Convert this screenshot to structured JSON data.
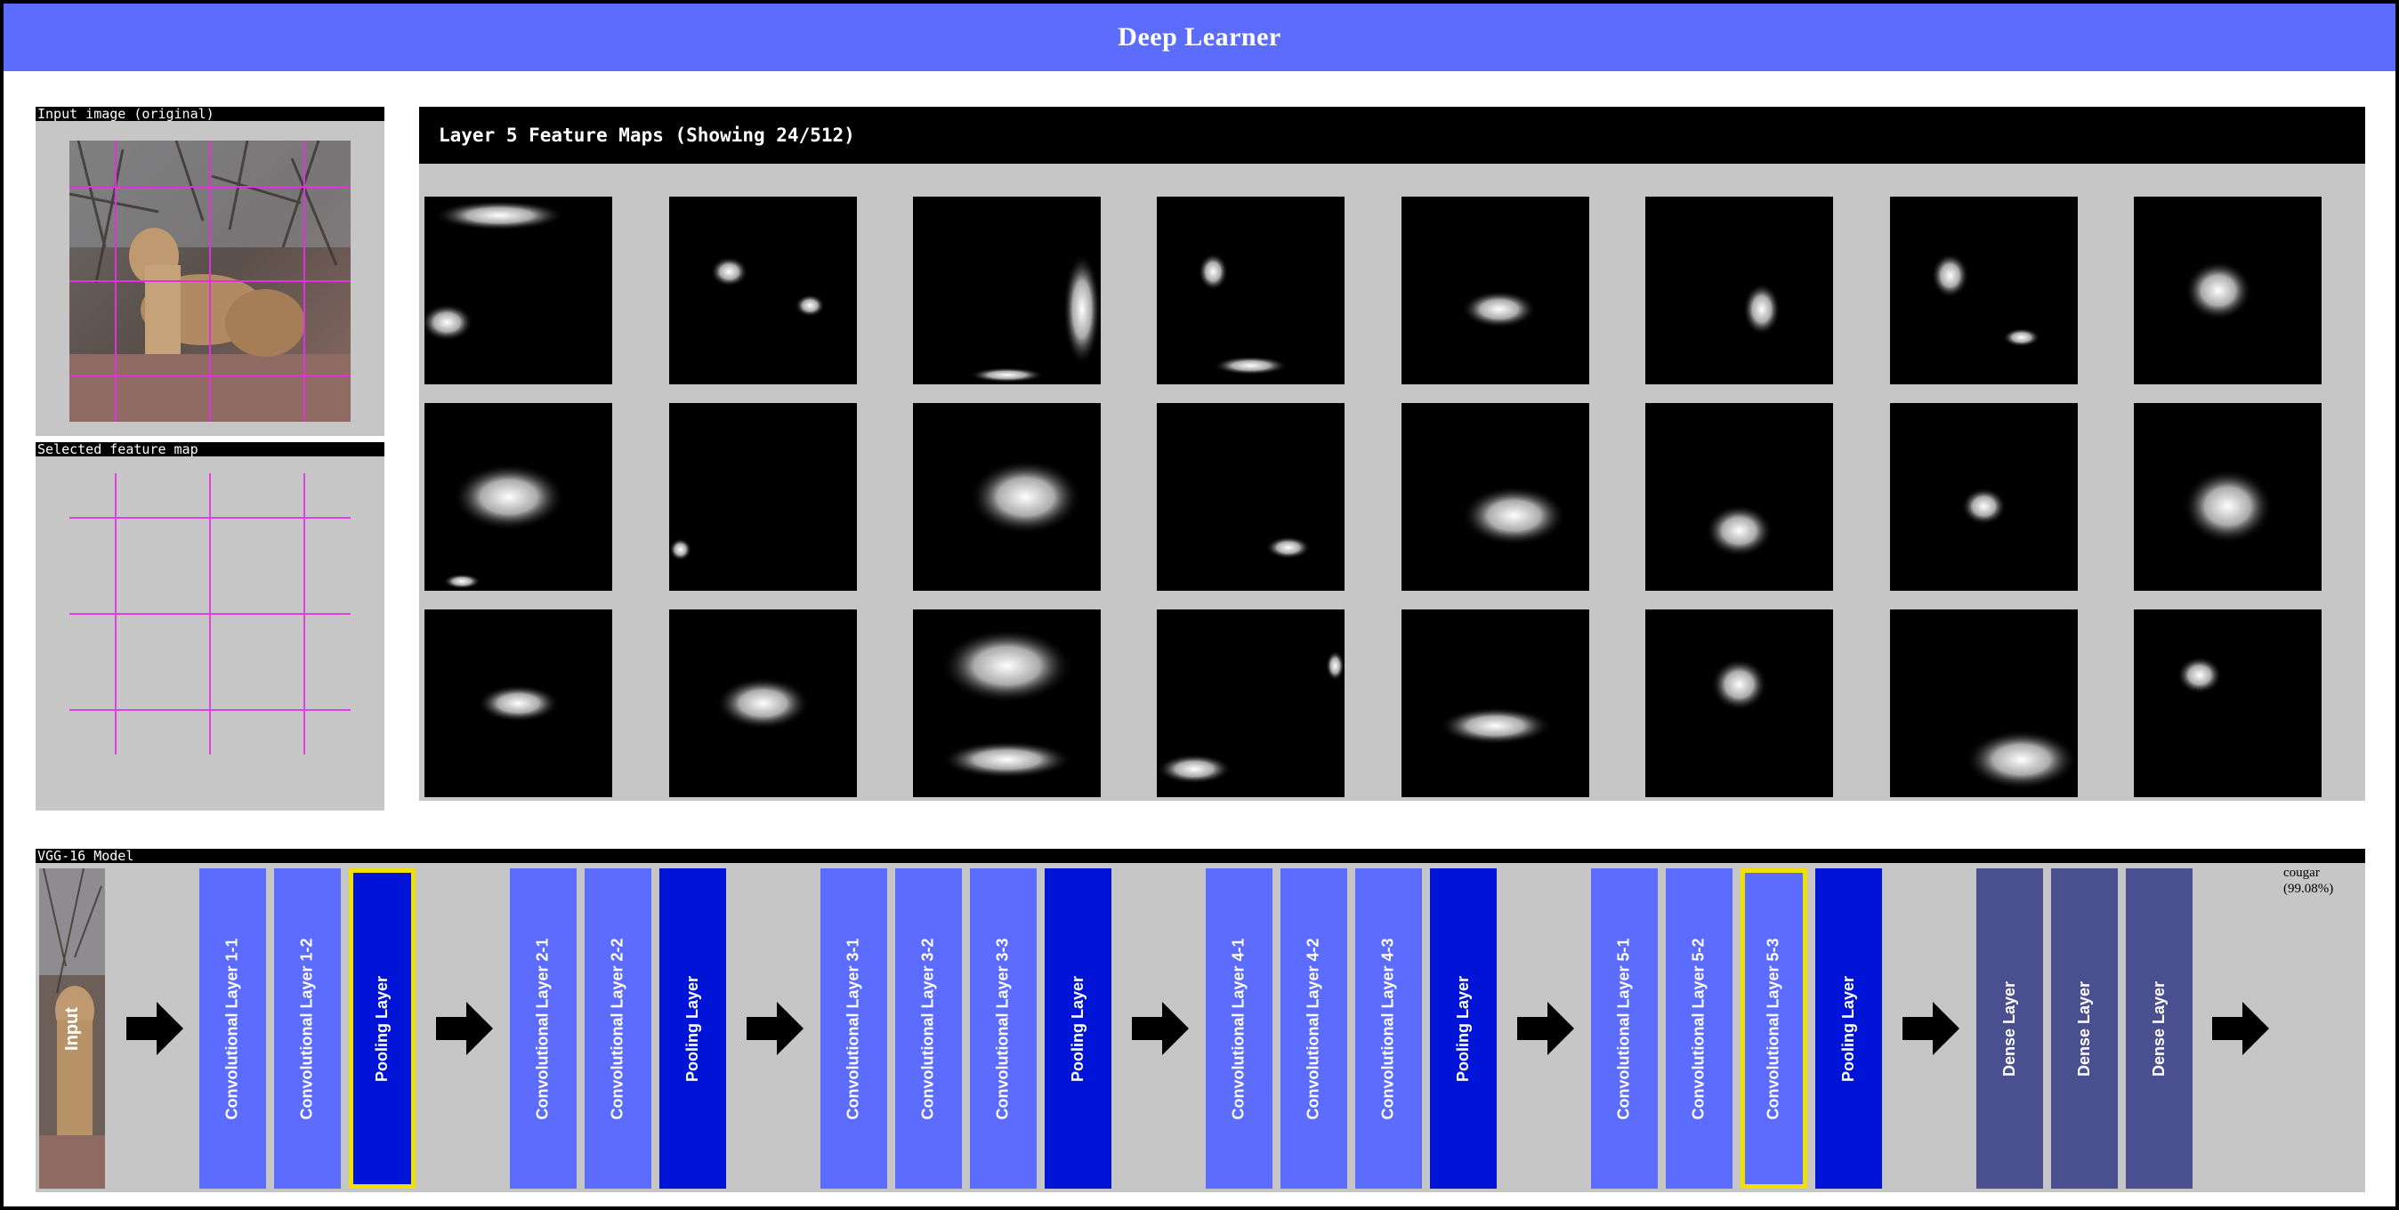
{
  "app": {
    "title": "Deep Learner"
  },
  "input_panel": {
    "label": "Input image (original)"
  },
  "selected_panel": {
    "label": "Selected feature map"
  },
  "feature_maps": {
    "title": "Layer 5 Feature Maps (Showing 24/512)"
  },
  "model": {
    "label": "VGG-16 Model",
    "input_label": "Input",
    "layers": [
      {
        "label": "Convolutional Layer 1-1",
        "type": "conv"
      },
      {
        "label": "Convolutional Layer 1-2",
        "type": "conv"
      },
      {
        "label": "Pooling Layer",
        "type": "pool",
        "selected": true
      },
      {
        "label": "Convolutional Layer 2-1",
        "type": "conv"
      },
      {
        "label": "Convolutional Layer 2-2",
        "type": "conv"
      },
      {
        "label": "Pooling Layer",
        "type": "pool"
      },
      {
        "label": "Convolutional Layer 3-1",
        "type": "conv"
      },
      {
        "label": "Convolutional Layer 3-2",
        "type": "conv"
      },
      {
        "label": "Convolutional Layer 3-3",
        "type": "conv"
      },
      {
        "label": "Pooling Layer",
        "type": "pool"
      },
      {
        "label": "Convolutional Layer 4-1",
        "type": "conv"
      },
      {
        "label": "Convolutional Layer 4-2",
        "type": "conv"
      },
      {
        "label": "Convolutional Layer 4-3",
        "type": "conv"
      },
      {
        "label": "Pooling Layer",
        "type": "pool"
      },
      {
        "label": "Convolutional Layer 5-1",
        "type": "conv"
      },
      {
        "label": "Convolutional Layer 5-2",
        "type": "conv"
      },
      {
        "label": "Convolutional Layer 5-3",
        "type": "conv",
        "selected": true
      },
      {
        "label": "Pooling Layer",
        "type": "pool"
      },
      {
        "label": "Dense Layer",
        "type": "dense"
      },
      {
        "label": "Dense Layer",
        "type": "dense"
      },
      {
        "label": "Dense Layer",
        "type": "dense"
      }
    ],
    "prediction": {
      "label": "cougar",
      "confidence": "(99.08%)"
    }
  },
  "colors": {
    "header": "#5b6cff",
    "conv": "#5b6cff",
    "pool": "#0014d8",
    "dense": "#4a4f90",
    "selected_outline": "#f0e000",
    "grid": "#e040e0"
  },
  "icons": {
    "arrow": "right-arrow-icon"
  }
}
